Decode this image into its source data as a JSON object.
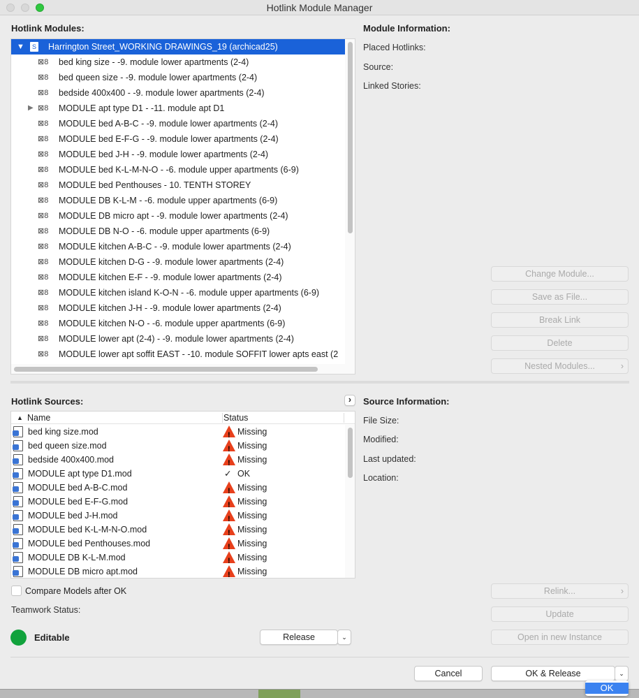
{
  "window": {
    "title": "Hotlink Module Manager"
  },
  "modules": {
    "label": "Hotlink Modules:",
    "root": "Harrington Street_WORKING DRAWINGS_19 (archicad25)",
    "items": [
      {
        "text": "bed king size - -9. module lower apartments (2-4)",
        "expandable": false
      },
      {
        "text": "bed queen size - -9. module lower apartments (2-4)",
        "expandable": false
      },
      {
        "text": "bedside 400x400 - -9. module lower apartments (2-4)",
        "expandable": false
      },
      {
        "text": "MODULE apt type D1 - -11. module apt D1",
        "expandable": true
      },
      {
        "text": "MODULE bed A-B-C - -9. module lower apartments (2-4)",
        "expandable": false
      },
      {
        "text": "MODULE bed E-F-G - -9. module lower apartments (2-4)",
        "expandable": false
      },
      {
        "text": "MODULE bed J-H - -9. module lower apartments (2-4)",
        "expandable": false
      },
      {
        "text": "MODULE bed K-L-M-N-O - -6. module upper apartments (6-9)",
        "expandable": false
      },
      {
        "text": "MODULE bed Penthouses - 10. TENTH STOREY",
        "expandable": false
      },
      {
        "text": "MODULE DB K-L-M - -6. module upper apartments (6-9)",
        "expandable": false
      },
      {
        "text": "MODULE DB micro apt - -9. module lower apartments (2-4)",
        "expandable": false
      },
      {
        "text": "MODULE DB N-O - -6. module upper apartments (6-9)",
        "expandable": false
      },
      {
        "text": "MODULE kitchen A-B-C - -9. module lower apartments (2-4)",
        "expandable": false
      },
      {
        "text": "MODULE kitchen D-G - -9. module lower apartments (2-4)",
        "expandable": false
      },
      {
        "text": "MODULE kitchen E-F - -9. module lower apartments (2-4)",
        "expandable": false
      },
      {
        "text": "MODULE kitchen island K-O-N - -6. module upper apartments (6-9)",
        "expandable": false
      },
      {
        "text": "MODULE kitchen J-H - -9. module lower apartments (2-4)",
        "expandable": false
      },
      {
        "text": "MODULE kitchen N-O - -6. module upper apartments (6-9)",
        "expandable": false
      },
      {
        "text": "MODULE lower apt (2-4) - -9. module lower apartments (2-4)",
        "expandable": false
      },
      {
        "text": "MODULE lower apt soffit EAST - -10. module SOFFIT lower apts east (2",
        "expandable": false
      }
    ]
  },
  "module_info": {
    "title": "Module Information:",
    "fields": [
      "Placed Hotlinks:",
      "Source:",
      "Linked Stories:"
    ],
    "buttons": [
      "Change Module...",
      "Save as File...",
      "Break Link",
      "Delete",
      "Nested Modules..."
    ]
  },
  "sources": {
    "label": "Hotlink Sources:",
    "col_name": "Name",
    "col_status": "Status",
    "rows": [
      {
        "name": "bed king size.mod",
        "status": "Missing"
      },
      {
        "name": "bed queen size.mod",
        "status": "Missing"
      },
      {
        "name": "bedside 400x400.mod",
        "status": "Missing"
      },
      {
        "name": "MODULE apt type D1.mod",
        "status": "OK"
      },
      {
        "name": "MODULE bed A-B-C.mod",
        "status": "Missing"
      },
      {
        "name": "MODULE bed E-F-G.mod",
        "status": "Missing"
      },
      {
        "name": "MODULE bed J-H.mod",
        "status": "Missing"
      },
      {
        "name": "MODULE bed K-L-M-N-O.mod",
        "status": "Missing"
      },
      {
        "name": "MODULE bed Penthouses.mod",
        "status": "Missing"
      },
      {
        "name": "MODULE DB K-L-M.mod",
        "status": "Missing"
      },
      {
        "name": "MODULE DB micro apt.mod",
        "status": "Missing"
      }
    ]
  },
  "source_info": {
    "title": "Source Information:",
    "fields": [
      "File Size:",
      "Modified:",
      "Last updated:",
      "Location:"
    ],
    "buttons": [
      "Relink...",
      "Update",
      "Open in new Instance"
    ]
  },
  "compare": {
    "label": "Compare Models after OK",
    "checked": false
  },
  "teamwork": {
    "label": "Teamwork Status:",
    "status": "Editable",
    "status_color": "#11a23c",
    "release": "Release"
  },
  "footer": {
    "cancel": "Cancel",
    "ok_release": "OK & Release",
    "popup_ok": "OK"
  },
  "colors": {
    "selection": "#1a62d9",
    "warning": "#e8401c"
  }
}
